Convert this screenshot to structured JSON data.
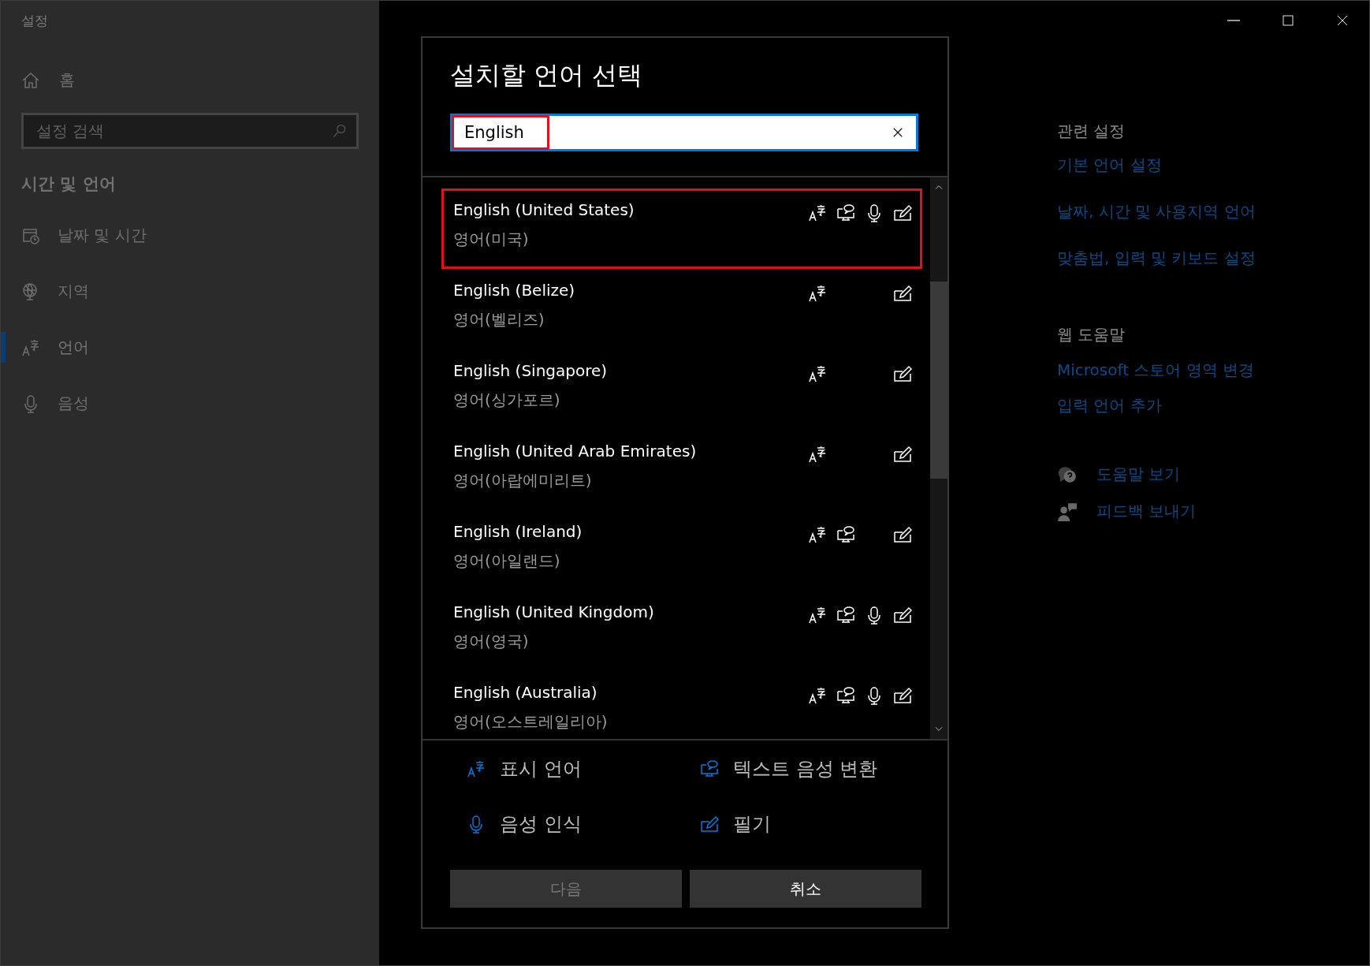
{
  "window": {
    "title": "설정"
  },
  "sidebar": {
    "home": "홈",
    "search_placeholder": "설정 검색",
    "section": "시간 및 언어",
    "items": [
      {
        "label": "날짜 및 시간",
        "selected": false
      },
      {
        "label": "지역",
        "selected": false
      },
      {
        "label": "언어",
        "selected": true
      },
      {
        "label": "음성",
        "selected": false
      }
    ]
  },
  "dialog": {
    "title": "설치할 언어 선택",
    "search": {
      "value": "English",
      "highlighted": true
    },
    "languages": [
      {
        "name": "English (United States)",
        "native": "영어(미국)",
        "highlighted": true,
        "features": {
          "display_language": true,
          "text_to_speech": true,
          "speech_recognition": true,
          "handwriting": true
        }
      },
      {
        "name": "English (Belize)",
        "native": "영어(벨리즈)",
        "highlighted": false,
        "features": {
          "display_language": true,
          "text_to_speech": false,
          "speech_recognition": false,
          "handwriting": true
        }
      },
      {
        "name": "English (Singapore)",
        "native": "영어(싱가포르)",
        "highlighted": false,
        "features": {
          "display_language": true,
          "text_to_speech": false,
          "speech_recognition": false,
          "handwriting": true
        }
      },
      {
        "name": "English (United Arab Emirates)",
        "native": "영어(아랍에미리트)",
        "highlighted": false,
        "features": {
          "display_language": true,
          "text_to_speech": false,
          "speech_recognition": false,
          "handwriting": true
        }
      },
      {
        "name": "English (Ireland)",
        "native": "영어(아일랜드)",
        "highlighted": false,
        "features": {
          "display_language": true,
          "text_to_speech": true,
          "speech_recognition": false,
          "handwriting": true
        }
      },
      {
        "name": "English (United Kingdom)",
        "native": "영어(영국)",
        "highlighted": false,
        "features": {
          "display_language": true,
          "text_to_speech": true,
          "speech_recognition": true,
          "handwriting": true
        }
      },
      {
        "name": "English (Australia)",
        "native": "영어(오스트레일리아)",
        "highlighted": false,
        "features": {
          "display_language": true,
          "text_to_speech": true,
          "speech_recognition": true,
          "handwriting": true
        }
      }
    ],
    "legend": [
      {
        "label": "표시 언어"
      },
      {
        "label": "텍스트 음성 변환"
      },
      {
        "label": "음성 인식"
      },
      {
        "label": "필기"
      }
    ],
    "buttons": [
      {
        "label": "다음",
        "disabled": true
      },
      {
        "label": "취소",
        "disabled": false
      }
    ]
  },
  "related": {
    "heading": "관련 설정",
    "links": [
      "기본 언어 설정",
      "날짜, 시간 및 사용지역 언어",
      "맞춤법, 입력 및 키보드 설정"
    ]
  },
  "web_help": {
    "heading": "웹 도움말",
    "links": [
      "Microsoft 스토어 영역 변경",
      "입력 언어 추가"
    ]
  },
  "help_links": [
    {
      "label": "도움말 보기"
    },
    {
      "label": "피드백 보내기"
    }
  ]
}
